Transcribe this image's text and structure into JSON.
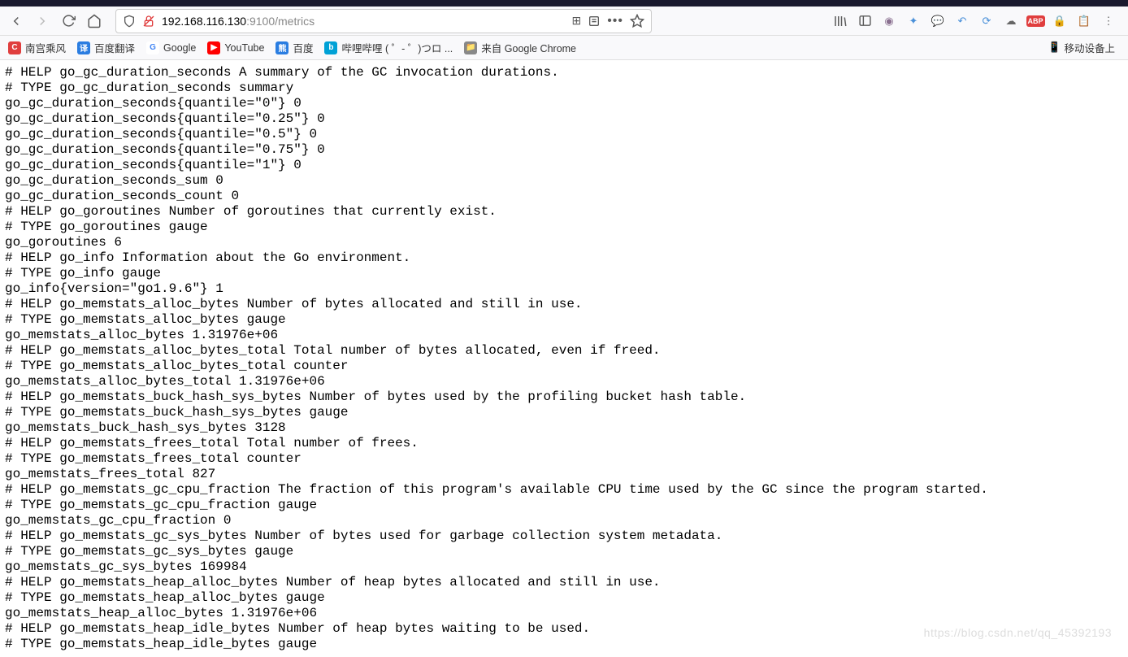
{
  "url": {
    "shield": "shield",
    "lock": "insecure",
    "host_prefix": "",
    "host": "192.168.116.130",
    "port_path": ":9100/metrics"
  },
  "bookmarks": [
    {
      "label": "南宫乘风",
      "icon_bg": "#e03e3e",
      "icon_text": "C"
    },
    {
      "label": "百度翻译",
      "icon_bg": "#2a7de1",
      "icon_text": "译"
    },
    {
      "label": "Google",
      "icon_bg": "#ffffff",
      "icon_text": "G",
      "color": "#4285f4"
    },
    {
      "label": "YouTube",
      "icon_bg": "#ff0000",
      "icon_text": "▶"
    },
    {
      "label": "百度",
      "icon_bg": "#2a7de1",
      "icon_text": "熊"
    },
    {
      "label": "哔哩哔哩 ( ゜- ゜)つロ ...",
      "icon_bg": "#00a1d6",
      "icon_text": "b"
    },
    {
      "label": "来自 Google Chrome",
      "icon_bg": "#888",
      "icon_text": "📁"
    }
  ],
  "mobile_label": "移动设备上",
  "metrics_lines": [
    "# HELP go_gc_duration_seconds A summary of the GC invocation durations.",
    "# TYPE go_gc_duration_seconds summary",
    "go_gc_duration_seconds{quantile=\"0\"} 0",
    "go_gc_duration_seconds{quantile=\"0.25\"} 0",
    "go_gc_duration_seconds{quantile=\"0.5\"} 0",
    "go_gc_duration_seconds{quantile=\"0.75\"} 0",
    "go_gc_duration_seconds{quantile=\"1\"} 0",
    "go_gc_duration_seconds_sum 0",
    "go_gc_duration_seconds_count 0",
    "# HELP go_goroutines Number of goroutines that currently exist.",
    "# TYPE go_goroutines gauge",
    "go_goroutines 6",
    "# HELP go_info Information about the Go environment.",
    "# TYPE go_info gauge",
    "go_info{version=\"go1.9.6\"} 1",
    "# HELP go_memstats_alloc_bytes Number of bytes allocated and still in use.",
    "# TYPE go_memstats_alloc_bytes gauge",
    "go_memstats_alloc_bytes 1.31976e+06",
    "# HELP go_memstats_alloc_bytes_total Total number of bytes allocated, even if freed.",
    "# TYPE go_memstats_alloc_bytes_total counter",
    "go_memstats_alloc_bytes_total 1.31976e+06",
    "# HELP go_memstats_buck_hash_sys_bytes Number of bytes used by the profiling bucket hash table.",
    "# TYPE go_memstats_buck_hash_sys_bytes gauge",
    "go_memstats_buck_hash_sys_bytes 3128",
    "# HELP go_memstats_frees_total Total number of frees.",
    "# TYPE go_memstats_frees_total counter",
    "go_memstats_frees_total 827",
    "# HELP go_memstats_gc_cpu_fraction The fraction of this program's available CPU time used by the GC since the program started.",
    "# TYPE go_memstats_gc_cpu_fraction gauge",
    "go_memstats_gc_cpu_fraction 0",
    "# HELP go_memstats_gc_sys_bytes Number of bytes used for garbage collection system metadata.",
    "# TYPE go_memstats_gc_sys_bytes gauge",
    "go_memstats_gc_sys_bytes 169984",
    "# HELP go_memstats_heap_alloc_bytes Number of heap bytes allocated and still in use.",
    "# TYPE go_memstats_heap_alloc_bytes gauge",
    "go_memstats_heap_alloc_bytes 1.31976e+06",
    "# HELP go_memstats_heap_idle_bytes Number of heap bytes waiting to be used.",
    "# TYPE go_memstats_heap_idle_bytes gauge"
  ],
  "watermark": "https://blog.csdn.net/qq_45392193"
}
